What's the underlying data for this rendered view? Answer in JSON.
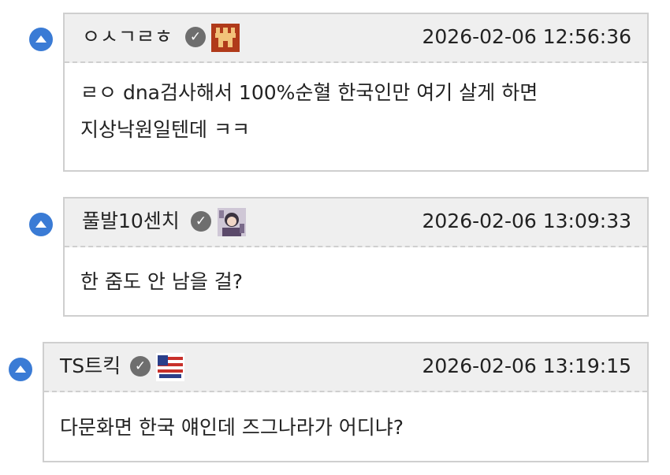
{
  "comments": [
    {
      "nickname": "ㅇㅅㄱㄹㅎ",
      "badge_icon": "fortress-badge-icon",
      "timestamp": "2026-02-06 12:56:36",
      "text_lines": [
        "ㄹㅇ dna검사해서 100%순혈 한국인만 여기 살게 하면",
        "지상낙원일텐데 ㅋㅋ"
      ]
    },
    {
      "nickname": "풀발10센치",
      "badge_icon": "anime-avatar-badge-icon",
      "timestamp": "2026-02-06 13:09:33",
      "text_lines": [
        "한 줌도 안 남을 걸?"
      ]
    },
    {
      "nickname": "TS트킥",
      "badge_icon": "flag-badge-icon",
      "timestamp": "2026-02-06 13:19:15",
      "text_lines": [
        "다문화면 한국 얘인데 즈그나라가 어디냐?"
      ]
    }
  ],
  "colors": {
    "vote_button": "#3a7bd5",
    "header_bg": "#efefef",
    "border": "#cfcfcf",
    "verified_badge": "#6e6e6e"
  },
  "icons": {
    "vote": "upvote-triangle-icon",
    "verified": "verified-check-icon"
  }
}
